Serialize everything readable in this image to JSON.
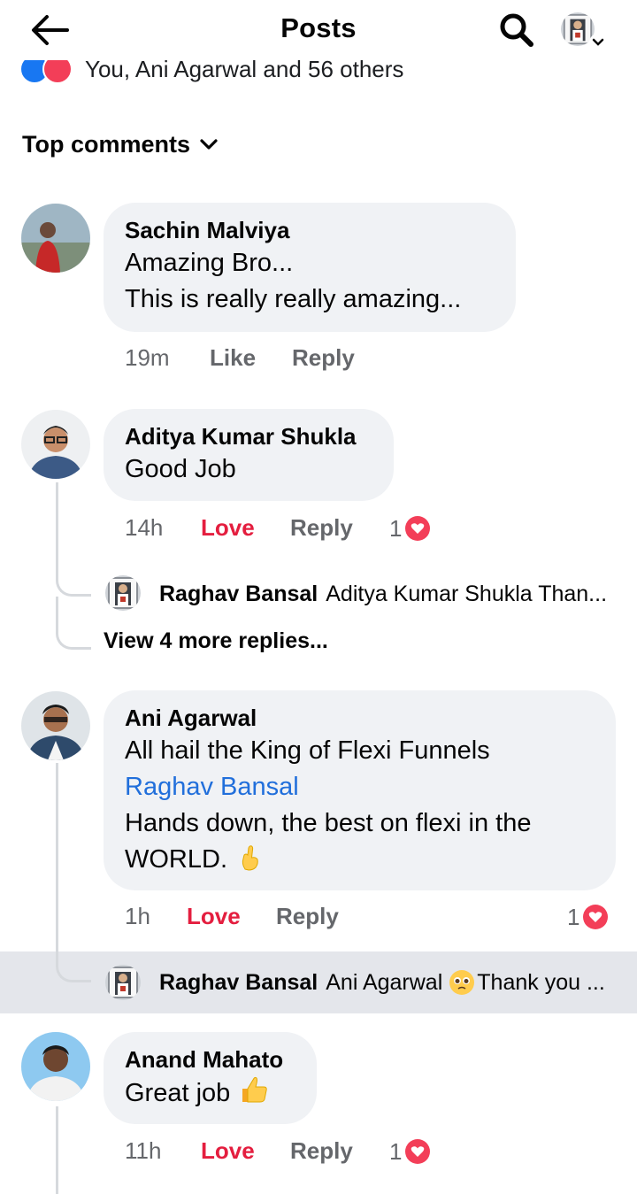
{
  "header": {
    "title": "Posts"
  },
  "reactions": {
    "summary": "You, Ani Agarwal and 56 others"
  },
  "sort": {
    "label": "Top comments"
  },
  "comments": [
    {
      "author": "Sachin Malviya",
      "lines": [
        "Amazing Bro...",
        "This is really really amazing..."
      ],
      "time": "19m",
      "like_label": "Like",
      "reply_label": "Reply"
    },
    {
      "author": "Aditya Kumar Shukla",
      "lines": [
        "Good Job"
      ],
      "time": "14h",
      "like_label": "Love",
      "reply_label": "Reply",
      "reaction_count": "1",
      "reply_preview": {
        "author": "Raghav Bansal",
        "text": "Aditya Kumar Shukla Than..."
      },
      "view_more": "View 4 more replies..."
    },
    {
      "author": "Ani Agarwal",
      "line1": "All hail the King of Flexi Funnels",
      "mention": "Raghav Bansal",
      "line3": "Hands down, the best on flexi in the",
      "line4": "WORLD.",
      "time": "1h",
      "like_label": "Love",
      "reply_label": "Reply",
      "reaction_count": "1",
      "reply_preview": {
        "author": "Raghav Bansal",
        "mention": "Ani Agarwal",
        "text": "Thank you ..."
      }
    },
    {
      "author": "Anand Mahato",
      "lines": [
        "Great job"
      ],
      "time": "11h",
      "like_label": "Love",
      "reply_label": "Reply",
      "reaction_count": "1"
    }
  ],
  "colors": {
    "bubble_bg": "#f0f2f5",
    "love": "#e41e3f",
    "mention": "#216fdb",
    "meta": "#65676b",
    "highlight_bg": "#e4e6eb"
  }
}
